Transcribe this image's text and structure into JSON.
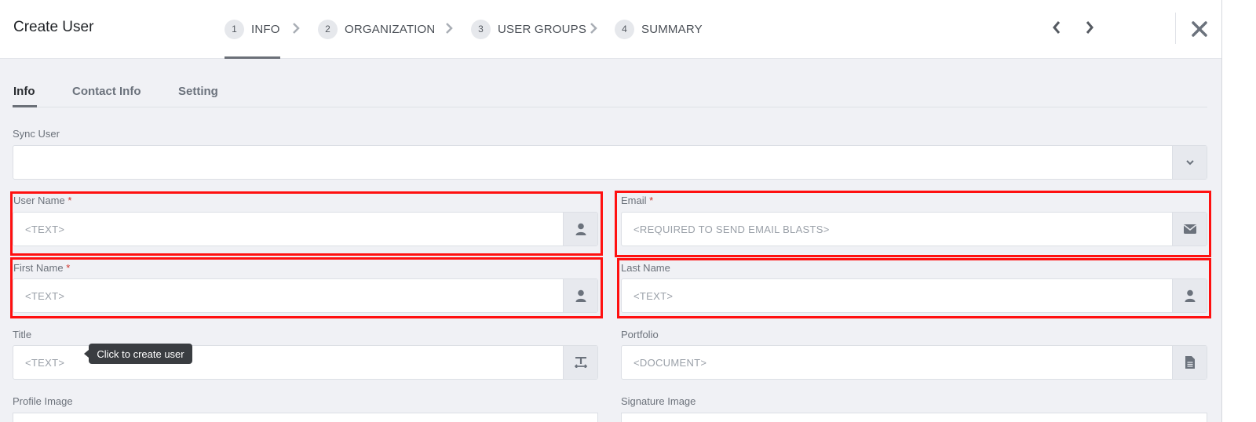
{
  "header": {
    "title": "Create User",
    "steps": [
      {
        "num": "1",
        "label": "INFO"
      },
      {
        "num": "2",
        "label": "ORGANIZATION"
      },
      {
        "num": "3",
        "label": "USER GROUPS"
      },
      {
        "num": "4",
        "label": "SUMMARY"
      }
    ]
  },
  "tabs": [
    {
      "label": "Info"
    },
    {
      "label": "Contact Info"
    },
    {
      "label": "Setting"
    }
  ],
  "form": {
    "sync_user": {
      "label": "Sync User",
      "value": ""
    },
    "user_name": {
      "label": "User Name",
      "required": "*",
      "placeholder": "<TEXT>"
    },
    "email": {
      "label": "Email",
      "required": "*",
      "placeholder": "<REQUIRED TO SEND EMAIL BLASTS>"
    },
    "first_name": {
      "label": "First Name",
      "required": "*",
      "placeholder": "<TEXT>"
    },
    "last_name": {
      "label": "Last Name",
      "placeholder": "<TEXT>"
    },
    "title": {
      "label": "Title",
      "placeholder": "<TEXT>"
    },
    "portfolio": {
      "label": "Portfolio",
      "placeholder": "<DOCUMENT>"
    },
    "profile_image": {
      "label": "Profile Image"
    },
    "signature_image": {
      "label": "Signature Image"
    }
  },
  "tooltip": {
    "text": "Click to create user"
  },
  "colors": {
    "highlight": "#ff1010",
    "accent": "#6b7078"
  },
  "icons": [
    "chevron-right-icon",
    "chevron-left-icon",
    "close-icon",
    "chevron-down-icon",
    "user-icon",
    "envelope-icon",
    "text-height-icon",
    "document-icon"
  ]
}
